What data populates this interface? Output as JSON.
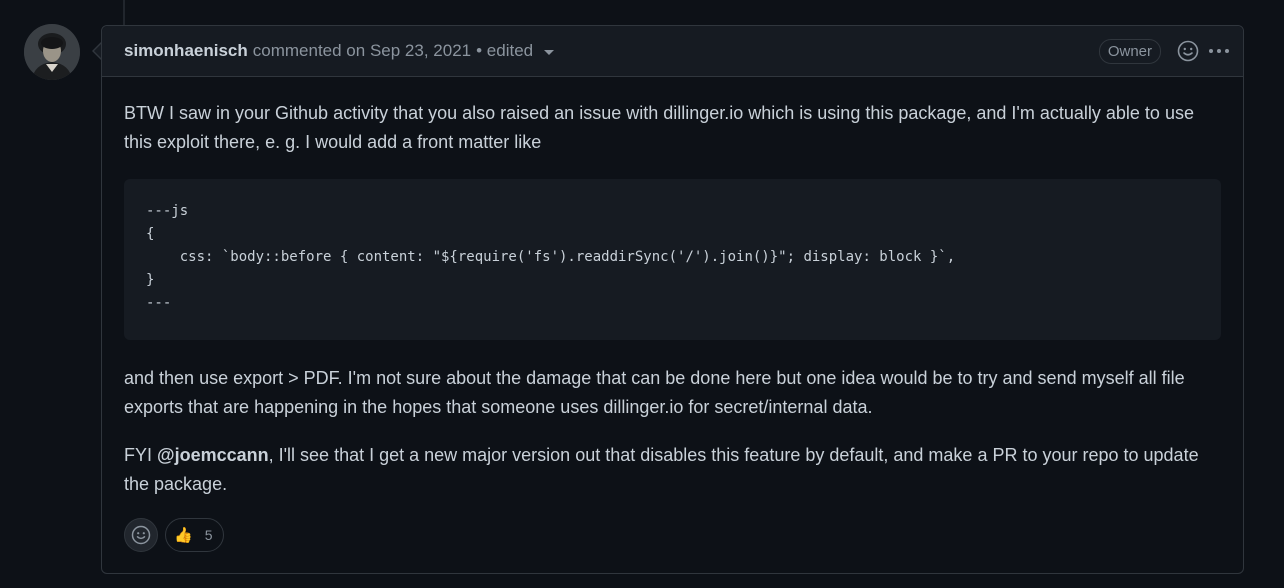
{
  "comment": {
    "author": "simonhaenisch",
    "commented_text": "commented on",
    "date": "Sep 23, 2021",
    "edited_label": "• edited",
    "owner_badge": "Owner"
  },
  "body": {
    "p1": "BTW I saw in your Github activity that you also raised an issue with dillinger.io which is using this package, and I'm actually able to use this exploit there, e. g. I would add a front matter like",
    "code_lines": [
      "---js",
      "{",
      "    css: `body::before { content: \"${require('fs').readdirSync('/').join()}\"; display: block }`,",
      "}",
      "---"
    ],
    "p2": "and then use export > PDF. I'm not sure about the damage that can be done here but one idea would be to try and send myself all file exports that are happening in the hopes that someone uses dillinger.io for secret/internal data.",
    "p3_prefix": "FYI ",
    "p3_mention": "@joemccann",
    "p3_suffix": ", I'll see that I get a new major version out that disables this feature by default, and make a PR to your repo to update the package."
  },
  "reactions": {
    "thumbs_up_emoji": "👍",
    "thumbs_up_count": "5"
  },
  "icons": {
    "add_reaction": "smiley-icon",
    "header_reaction": "smiley-icon",
    "more": "kebab-horizontal-icon",
    "edited_dropdown": "caret-down-icon"
  },
  "colors": {
    "background": "#0d1117",
    "header_bg": "#161b22",
    "border": "#30363d",
    "text": "#c9d1d9",
    "muted": "#8b949e"
  }
}
